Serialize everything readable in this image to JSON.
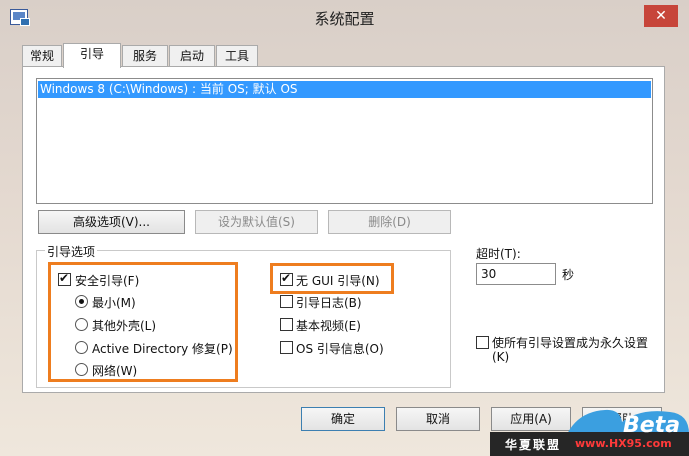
{
  "window": {
    "title": "系统配置",
    "close_glyph": "✕",
    "icon": "system-config-icon"
  },
  "tabs": [
    {
      "label": "常规",
      "active": false
    },
    {
      "label": "引导",
      "active": true
    },
    {
      "label": "服务",
      "active": false
    },
    {
      "label": "启动",
      "active": false
    },
    {
      "label": "工具",
      "active": false
    }
  ],
  "boot_list": {
    "items": [
      {
        "label": "Windows 8 (C:\\Windows) : 当前 OS; 默认 OS",
        "selected": true
      }
    ]
  },
  "list_buttons": {
    "advanced": "高级选项(V)...",
    "set_default": "设为默认值(S)",
    "delete": "删除(D)"
  },
  "boot_options": {
    "group_label": "引导选项",
    "safe_boot": {
      "label": "安全引导(F)",
      "checked": true
    },
    "radios": [
      {
        "label": "最小(M)",
        "checked": true
      },
      {
        "label": "其他外壳(L)",
        "checked": false
      },
      {
        "label": "Active Directory 修复(P)",
        "checked": false
      },
      {
        "label": "网络(W)",
        "checked": false
      }
    ],
    "checks": [
      {
        "label": "无 GUI 引导(N)",
        "checked": true
      },
      {
        "label": "引导日志(B)",
        "checked": false
      },
      {
        "label": "基本视频(E)",
        "checked": false
      },
      {
        "label": "OS 引导信息(O)",
        "checked": false
      }
    ]
  },
  "timeout": {
    "label": "超时(T):",
    "value": "30",
    "unit": "秒"
  },
  "permanent": {
    "label_line1": "使所有引导设置成为永久设置",
    "label_line2": "(K)",
    "checked": false
  },
  "footer": {
    "ok": "确定",
    "cancel": "取消",
    "apply": "应用(A)",
    "help": "帮助"
  },
  "highlight_color": "#ee7d1f",
  "selection_color": "#3399ff",
  "watermark": {
    "brand": "华夏联盟",
    "url": "www.HX95.com",
    "logo": "Beta"
  }
}
